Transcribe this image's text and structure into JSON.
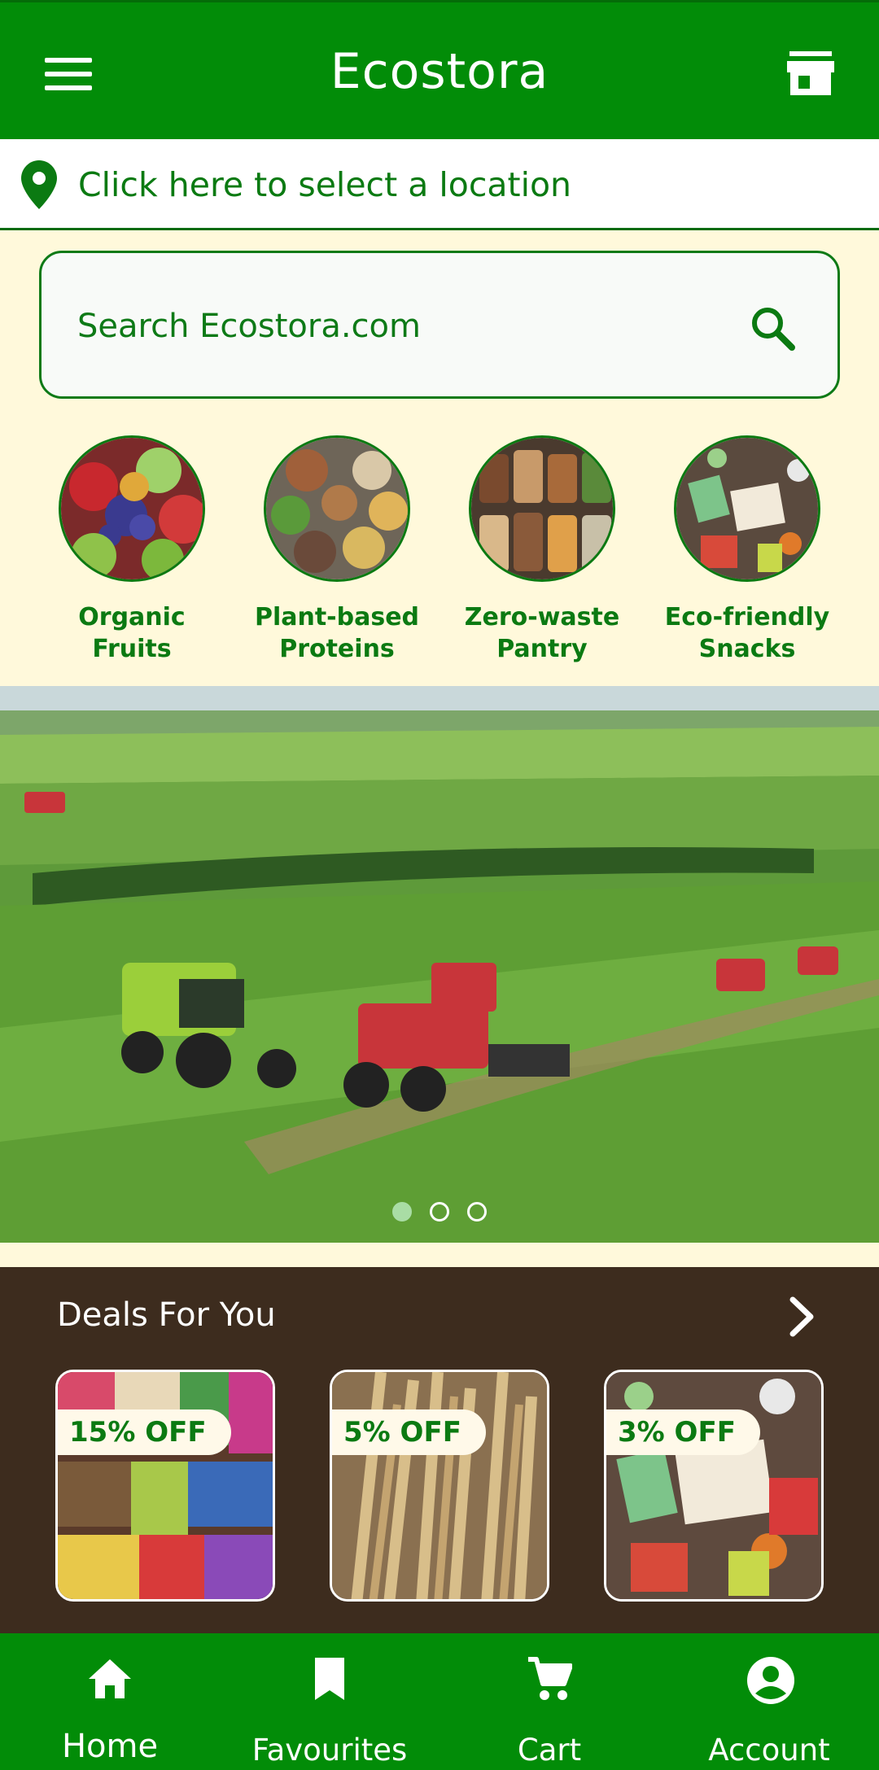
{
  "header": {
    "title": "Ecostora",
    "menu_icon": "hamburger-menu-icon",
    "store_icon": "storefront-icon",
    "bg_color": "#028C08"
  },
  "location": {
    "text": "Click here to select a location",
    "icon": "location-pin-icon"
  },
  "search": {
    "placeholder": "Search Ecostora.com",
    "value": "",
    "icon": "search-icon"
  },
  "categories": [
    {
      "label": "Organic\nFruits",
      "image": "fruits-photo"
    },
    {
      "label": "Plant-based\nProteins",
      "image": "grains-legumes-photo"
    },
    {
      "label": "Zero-waste\nPantry",
      "image": "jars-pantry-photo"
    },
    {
      "label": "Eco-friendly\nSnacks",
      "image": "snack-packages-photo"
    }
  ],
  "hero": {
    "image": "tractors-in-green-fields-photo",
    "slides": 3,
    "active_slide": 1
  },
  "deals": {
    "title": "Deals For You",
    "arrow_icon": "chevron-right-icon",
    "items": [
      {
        "badge": "15% OFF",
        "image": "snack-bags-photo"
      },
      {
        "badge": "5% OFF",
        "image": "wheat-photo"
      },
      {
        "badge": "3% OFF",
        "image": "eco-snacks-photo"
      }
    ],
    "bg_color": "#3D2C1E"
  },
  "nav": {
    "items": [
      {
        "label": "Home",
        "icon": "home-icon",
        "active": true
      },
      {
        "label": "Favourites",
        "icon": "bookmark-icon",
        "active": false
      },
      {
        "label": "Cart",
        "icon": "cart-icon",
        "active": false
      },
      {
        "label": "Account",
        "icon": "account-circle-icon",
        "active": false
      }
    ]
  }
}
